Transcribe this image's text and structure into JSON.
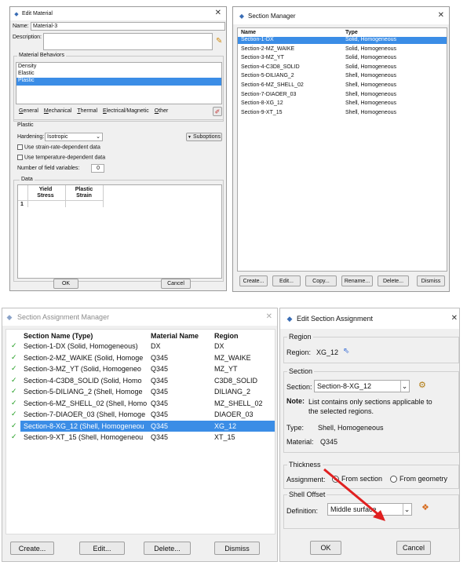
{
  "edit_material": {
    "title": "Edit Material",
    "name_label": "Name:",
    "name_value": "Material-3",
    "description_label": "Description:",
    "behaviors_label": "Material Behaviors",
    "behaviors": [
      "Density",
      "Elastic",
      "Plastic"
    ],
    "menu": [
      "General",
      "Mechanical",
      "Thermal",
      "Electrical/Magnetic",
      "Other"
    ],
    "plastic_label": "Plastic",
    "hardening_label": "Hardening:",
    "hardening_value": "Isotropic",
    "suboptions_label": "Suboptions",
    "cb_strain_rate": "Use strain-rate-dependent data",
    "cb_temperature": "Use temperature-dependent data",
    "field_vars_label": "Number of field variables:",
    "field_vars_value": "0",
    "data_label": "Data",
    "col1": "Yield\nStress",
    "col2": "Plastic\nStrain",
    "row1": "1",
    "ok": "OK",
    "cancel": "Cancel"
  },
  "section_manager": {
    "title": "Section Manager",
    "headers": [
      "Name",
      "Type"
    ],
    "rows": [
      [
        "Section-1-DX",
        "Solid, Homogeneous"
      ],
      [
        "Section-2-MZ_WAIKE",
        "Solid, Homogeneous"
      ],
      [
        "Section-3-MZ_YT",
        "Solid, Homogeneous"
      ],
      [
        "Section-4-C3D8_SOLID",
        "Solid, Homogeneous"
      ],
      [
        "Section-5-DILIANG_2",
        "Shell, Homogeneous"
      ],
      [
        "Section-6-MZ_SHELL_02",
        "Shell, Homogeneous"
      ],
      [
        "Section-7-DIAOER_03",
        "Shell, Homogeneous"
      ],
      [
        "Section-8-XG_12",
        "Shell, Homogeneous"
      ],
      [
        "Section-9-XT_15",
        "Shell, Homogeneous"
      ]
    ],
    "buttons": [
      "Create...",
      "Edit...",
      "Copy...",
      "Rename...",
      "Delete...",
      "Dismiss"
    ]
  },
  "assignment_manager": {
    "title": "Section Assignment Manager",
    "headers": [
      "Section Name (Type)",
      "Material Name",
      "Region"
    ],
    "rows": [
      [
        "Section-1-DX (Solid, Homogeneous)",
        "DX",
        "DX"
      ],
      [
        "Section-2-MZ_WAIKE (Solid, Homoge",
        "Q345",
        "MZ_WAIKE"
      ],
      [
        "Section-3-MZ_YT (Solid, Homogeneo",
        "Q345",
        "MZ_YT"
      ],
      [
        "Section-4-C3D8_SOLID (Solid, Homo",
        "Q345",
        "C3D8_SOLID"
      ],
      [
        "Section-5-DILIANG_2 (Shell, Homoge",
        "Q345",
        "DILIANG_2"
      ],
      [
        "Section-6-MZ_SHELL_02 (Shell, Homo",
        "Q345",
        "MZ_SHELL_02"
      ],
      [
        "Section-7-DIAOER_03 (Shell, Homoge",
        "Q345",
        "DIAOER_03"
      ],
      [
        "Section-8-XG_12 (Shell, Homogeneou",
        "Q345",
        "XG_12"
      ],
      [
        "Section-9-XT_15 (Shell, Homogeneou",
        "Q345",
        "XT_15"
      ]
    ],
    "buttons": [
      "Create...",
      "Edit...",
      "Delete...",
      "Dismiss"
    ]
  },
  "edit_assignment": {
    "title": "Edit Section Assignment",
    "region_group": "Region",
    "region_label": "Region:",
    "region_value": "XG_12",
    "section_group": "Section",
    "section_label": "Section:",
    "section_value": "Section-8-XG_12",
    "note_label": "Note:",
    "note_text": "List contains only sections applicable to the selected regions.",
    "type_label": "Type:",
    "type_value": "Shell, Homogeneous",
    "material_label": "Material:",
    "material_value": "Q345",
    "thickness_group": "Thickness",
    "assignment_label": "Assignment:",
    "from_section": "From section",
    "from_geometry": "From geometry",
    "offset_group": "Shell Offset",
    "definition_label": "Definition:",
    "definition_value": "Middle surface",
    "ok": "OK",
    "cancel": "Cancel"
  },
  "colors": {
    "selection": "#3b8de6",
    "arrow": "#e02020",
    "check": "#1c9b1c"
  }
}
